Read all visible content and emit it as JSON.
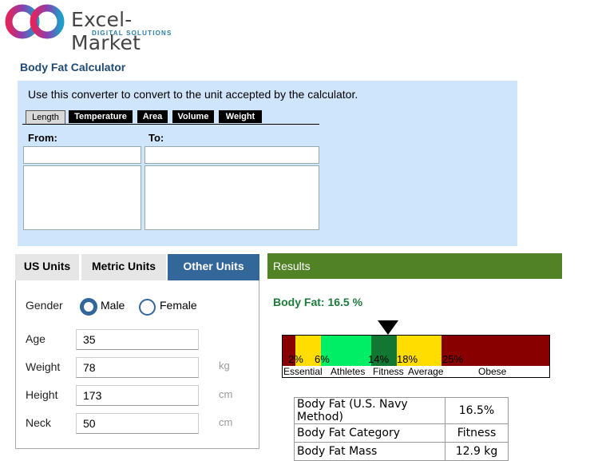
{
  "brand": {
    "name": "Excel-Market",
    "tagline": "DIGITAL SOLUTIONS"
  },
  "page_title": "Body Fat Calculator",
  "converter": {
    "description": "Use this converter to convert to the unit accepted by the calculator.",
    "tabs": [
      "Length",
      "Temperature",
      "Area",
      "Volume",
      "Weight"
    ],
    "active_tab": "Length",
    "from_label": "From:",
    "to_label": "To:",
    "from_value": "",
    "to_value": ""
  },
  "unit_tabs": [
    "US Units",
    "Metric Units",
    "Other Units"
  ],
  "active_unit_tab": "Other Units",
  "form": {
    "gender_label": "Gender",
    "gender_options": [
      "Male",
      "Female"
    ],
    "gender_selected": "Male",
    "age_label": "Age",
    "age_value": "35",
    "weight_label": "Weight",
    "weight_value": "78",
    "weight_unit": "kg",
    "height_label": "Height",
    "height_value": "173",
    "height_unit": "cm",
    "neck_label": "Neck",
    "neck_value": "50",
    "neck_unit": "cm"
  },
  "results": {
    "header": "Results",
    "body_fat_text": "Body Fat: 16.5 %",
    "scale": {
      "value": 16.5,
      "markers": [
        "2%",
        "6%",
        "14%",
        "18%",
        "25%"
      ],
      "categories": [
        "Essential",
        "Athletes",
        "Fitness",
        "Average",
        "Obese"
      ],
      "colors": {
        "essential": "#ffdd00",
        "athletes": "#00ee66",
        "fitness": "#117733",
        "average": "#ffdd00",
        "obese": "#880000"
      }
    },
    "table": [
      {
        "label": "Body Fat (U.S. Navy Method)",
        "value": "16.5%"
      },
      {
        "label": "Body Fat Category",
        "value": "Fitness"
      },
      {
        "label": "Body Fat Mass",
        "value": "12.9 kg"
      }
    ]
  }
}
